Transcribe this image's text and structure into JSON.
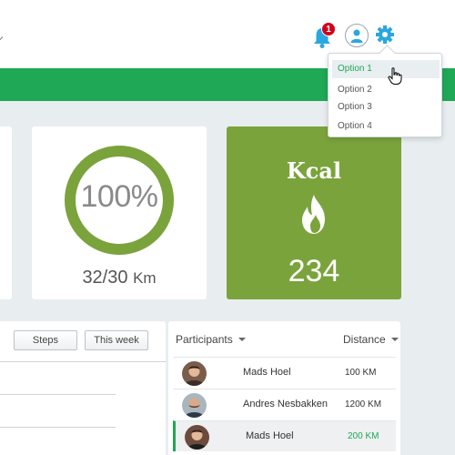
{
  "header": {
    "notifications_count": "1",
    "icons": [
      "bell-icon",
      "user-icon",
      "gear-icon"
    ]
  },
  "dropdown": {
    "items": [
      "Option 1",
      "Option 2",
      "Option 3",
      "Option 4"
    ],
    "active_index": 0
  },
  "progress_card": {
    "percent_label": "100%",
    "progress": 1.0,
    "distance_value": "32/30",
    "distance_unit": "Km"
  },
  "kcal_card": {
    "title": "Kcal",
    "value": "234",
    "icon": "flame-icon"
  },
  "filters": {
    "steps_label": "Steps",
    "period_label": "This week"
  },
  "participants": {
    "header_name": "Participants",
    "header_distance": "Distance",
    "rows": [
      {
        "name": "Mads Hoel",
        "distance": "100 KM",
        "highlight": false
      },
      {
        "name": "Andres Nesbakken",
        "distance": "1200 KM",
        "highlight": false
      },
      {
        "name": "Mads Hoel",
        "distance": "200 KM",
        "highlight": true
      }
    ]
  },
  "colors": {
    "brand_green": "#1fa855",
    "ring_green": "#7aa33c",
    "badge_red": "#d0021b"
  }
}
